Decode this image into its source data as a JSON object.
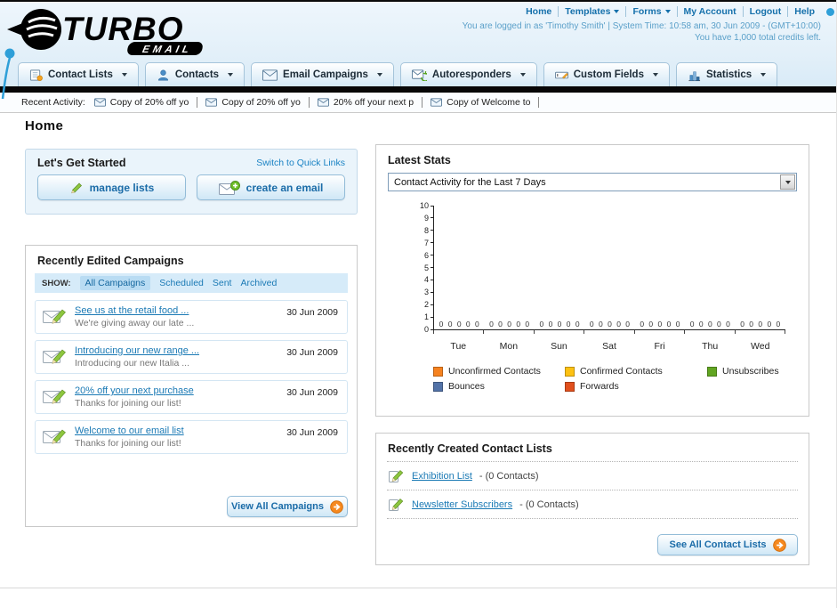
{
  "brand": {
    "name": "TURBO",
    "sub": "EMAIL"
  },
  "top_nav": {
    "links": [
      "Home",
      "Templates",
      "Forms",
      "My Account",
      "Logout",
      "Help"
    ]
  },
  "session": {
    "login_info": "You are logged in as 'Timothy Smith' | System Time: 10:58 am, 30 Jun 2009 - (GMT+10:00)",
    "credits_info": "You have 1,000 total credits left."
  },
  "main_nav": {
    "tabs": [
      {
        "label": "Contact Lists"
      },
      {
        "label": "Contacts"
      },
      {
        "label": "Email Campaigns"
      },
      {
        "label": "Autoresponders"
      },
      {
        "label": "Custom Fields"
      },
      {
        "label": "Statistics"
      }
    ]
  },
  "recent_activity": {
    "label": "Recent Activity:",
    "items": [
      "Copy of 20% off yo",
      "Copy of 20% off yo",
      "20% off your next p",
      "Copy of Welcome to"
    ]
  },
  "page": {
    "title": "Home"
  },
  "get_started": {
    "title": "Let's Get Started",
    "switch_link": "Switch to Quick Links",
    "manage_lists_label": "manage lists",
    "create_email_label": "create an email"
  },
  "campaigns": {
    "title": "Recently Edited Campaigns",
    "show_label": "SHOW:",
    "filters": [
      "All Campaigns",
      "Scheduled",
      "Sent",
      "Archived"
    ],
    "active_filter": "All Campaigns",
    "items": [
      {
        "title": "See us at the retail food ...",
        "subtitle": "We're giving away our late ...",
        "date": "30 Jun 2009"
      },
      {
        "title": "Introducing our new range ...",
        "subtitle": "Introducing our new Italia ...",
        "date": "30 Jun 2009"
      },
      {
        "title": "20% off your next purchase",
        "subtitle": "Thanks for joining our list!",
        "date": "30 Jun 2009"
      },
      {
        "title": "Welcome to our email list",
        "subtitle": "Thanks for joining our list!",
        "date": "30 Jun 2009"
      }
    ],
    "view_all_label": "View All Campaigns"
  },
  "stats": {
    "title": "Latest Stats",
    "selected_option": "Contact Activity for the Last 7 Days"
  },
  "contact_lists": {
    "title": "Recently Created Contact Lists",
    "items": [
      {
        "name": "Exhibition List",
        "detail": "- (0 Contacts)"
      },
      {
        "name": "Newsletter Subscribers",
        "detail": "- (0 Contacts)"
      }
    ],
    "see_all_label": "See All Contact Lists"
  },
  "chart_data": {
    "type": "bar",
    "title": "Contact Activity for the Last 7 Days",
    "categories": [
      "Tue",
      "Mon",
      "Sun",
      "Sat",
      "Fri",
      "Thu",
      "Wed"
    ],
    "series": [
      {
        "name": "Unconfirmed Contacts",
        "color": "#f6821f",
        "values": [
          0,
          0,
          0,
          0,
          0,
          0,
          0
        ]
      },
      {
        "name": "Confirmed Contacts",
        "color": "#fdc112",
        "values": [
          0,
          0,
          0,
          0,
          0,
          0,
          0
        ]
      },
      {
        "name": "Unsubscribes",
        "color": "#61a521",
        "values": [
          0,
          0,
          0,
          0,
          0,
          0,
          0
        ]
      },
      {
        "name": "Bounces",
        "color": "#5373a8",
        "values": [
          0,
          0,
          0,
          0,
          0,
          0,
          0
        ]
      },
      {
        "name": "Forwards",
        "color": "#e1501d",
        "values": [
          0,
          0,
          0,
          0,
          0,
          0,
          0
        ]
      }
    ],
    "ylim": [
      0,
      10
    ],
    "grid": false,
    "legend_position": "bottom"
  },
  "colors": {
    "accent_blue": "#1874ad",
    "orange": "#f6891f",
    "nav_bar_black": "#070707"
  }
}
